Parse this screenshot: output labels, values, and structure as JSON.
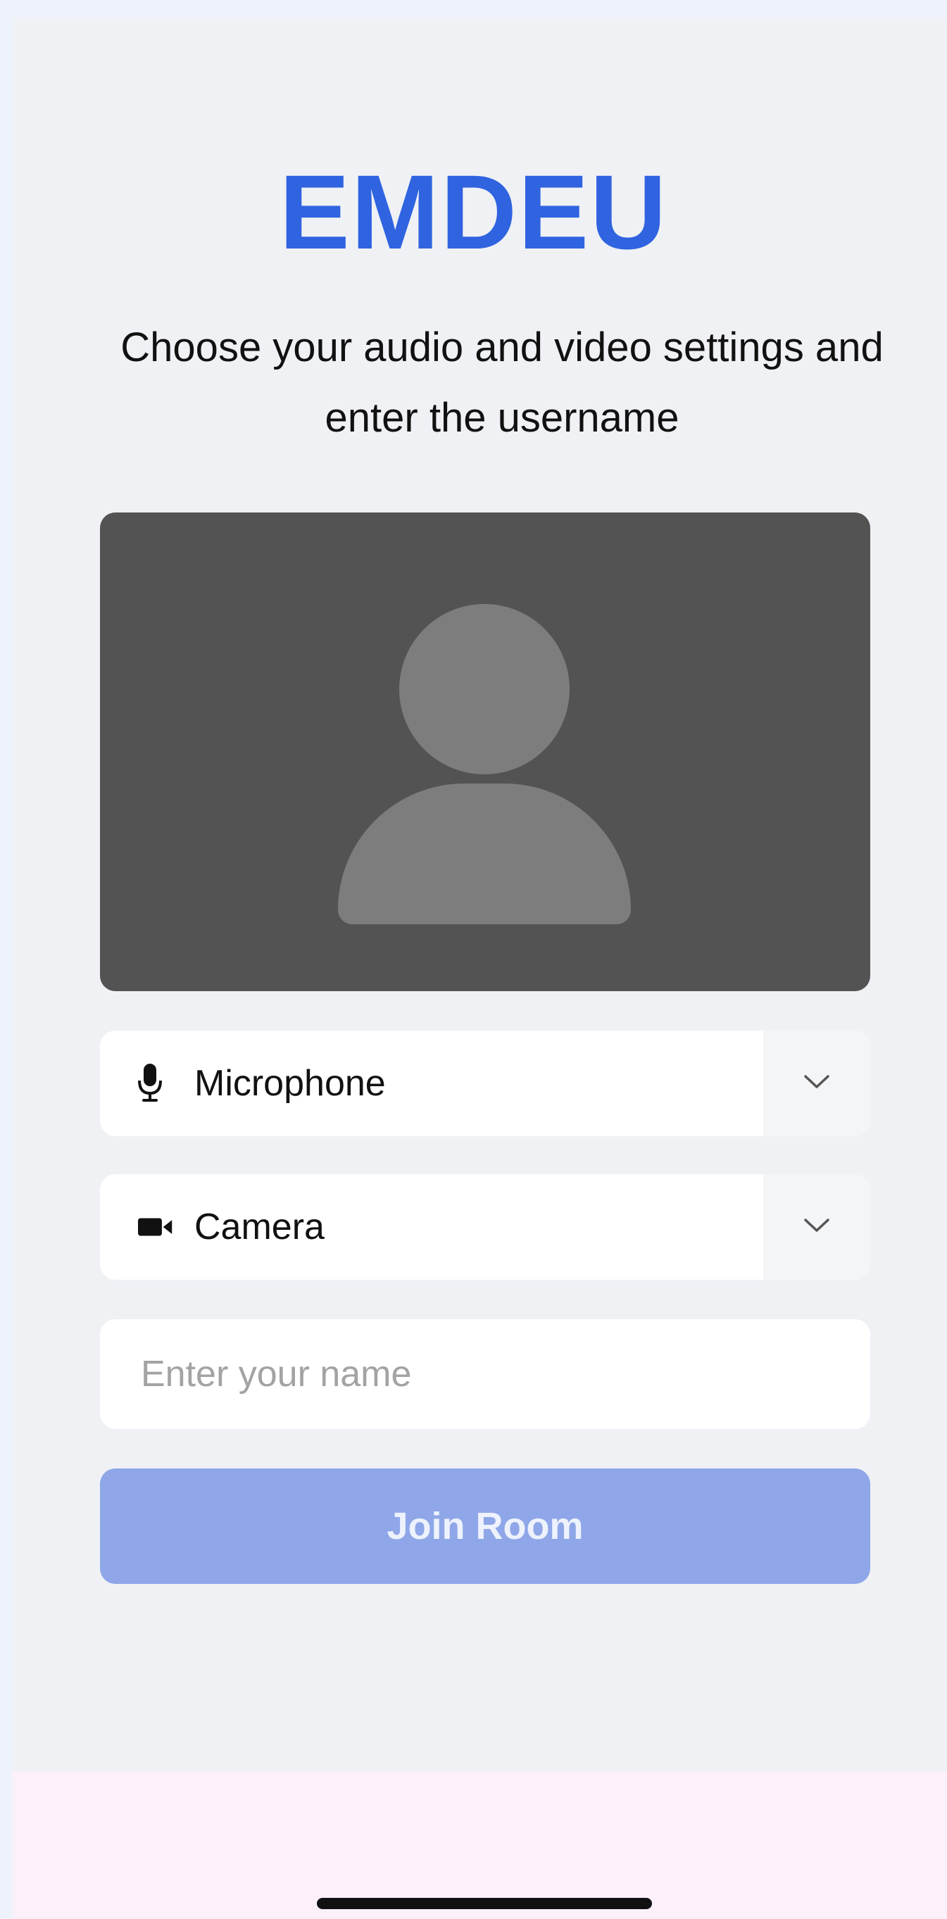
{
  "app": {
    "brand": "EMDEU",
    "subtitle_line1": "Choose your audio and video settings and",
    "subtitle_line2": "enter the username",
    "accent_color": "#2f63e0"
  },
  "preview": {
    "avatar_icon": "person-placeholder-icon"
  },
  "microphone": {
    "label": "Microphone",
    "icon": "microphone-icon",
    "toggle_icon": "chevron-down-icon"
  },
  "camera": {
    "label": "Camera",
    "icon": "video-camera-icon",
    "toggle_icon": "chevron-down-icon"
  },
  "name_input": {
    "placeholder": "Enter your name",
    "value": ""
  },
  "join_button": {
    "label": "Join Room",
    "color": "#8fa7e8"
  }
}
